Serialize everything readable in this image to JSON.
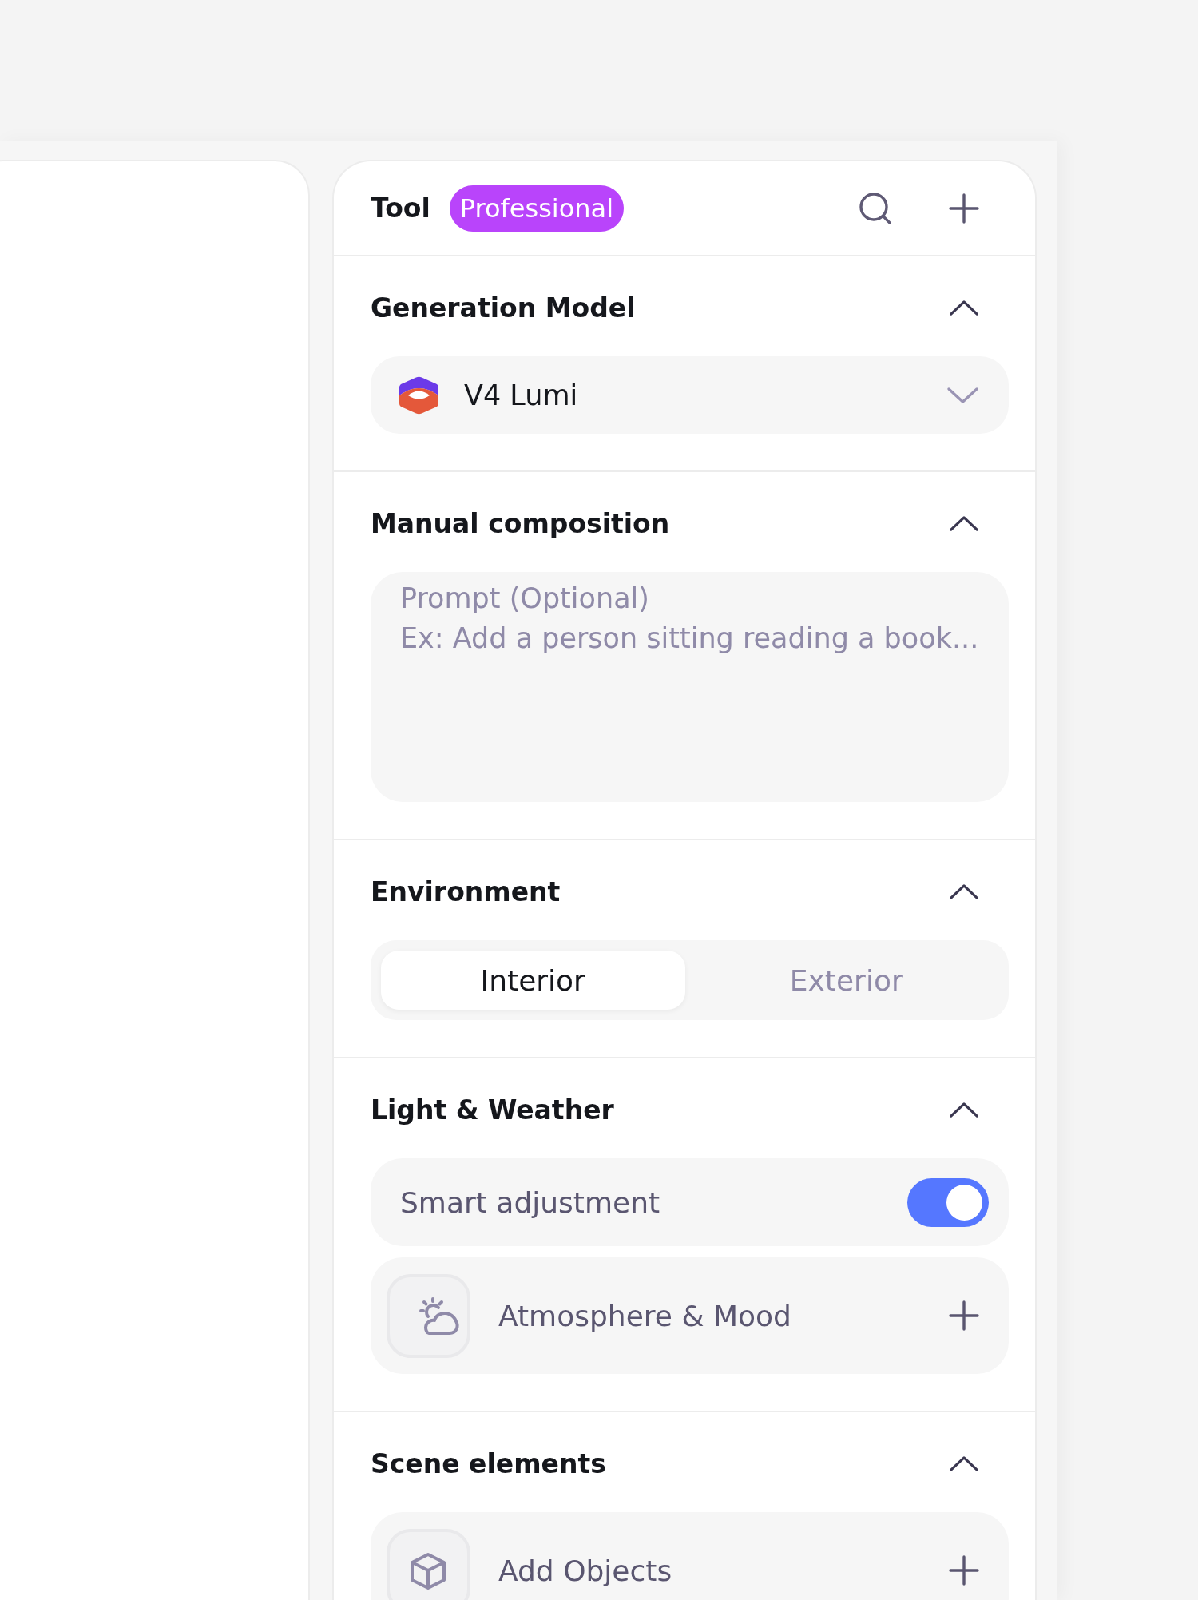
{
  "header": {
    "title": "Tool",
    "badge": "Professional"
  },
  "sections": [
    {
      "kind": "select",
      "title": "Generation Model",
      "expanded": true,
      "select": {
        "value": "V4 Lumi"
      }
    },
    {
      "kind": "textarea",
      "title": "Manual composition",
      "expanded": true,
      "field": {
        "label": "Prompt (Optional)",
        "placeholder": "Ex: Add a person sitting reading a book..."
      }
    },
    {
      "kind": "segmented",
      "title": "Environment",
      "expanded": true,
      "options": [
        {
          "label": "Interior",
          "selected": true
        },
        {
          "label": "Exterior",
          "selected": false
        }
      ]
    },
    {
      "kind": "rows",
      "title": "Light & Weather",
      "expanded": true,
      "rows": [
        {
          "kind": "toggle",
          "label": "Smart adjustment",
          "on": true
        },
        {
          "kind": "mood",
          "label": "Atmosphere & Mood"
        }
      ]
    },
    {
      "kind": "rows",
      "title": "Scene elements",
      "expanded": true,
      "rows": [
        {
          "kind": "objects",
          "label": "Add Objects"
        }
      ]
    }
  ]
}
